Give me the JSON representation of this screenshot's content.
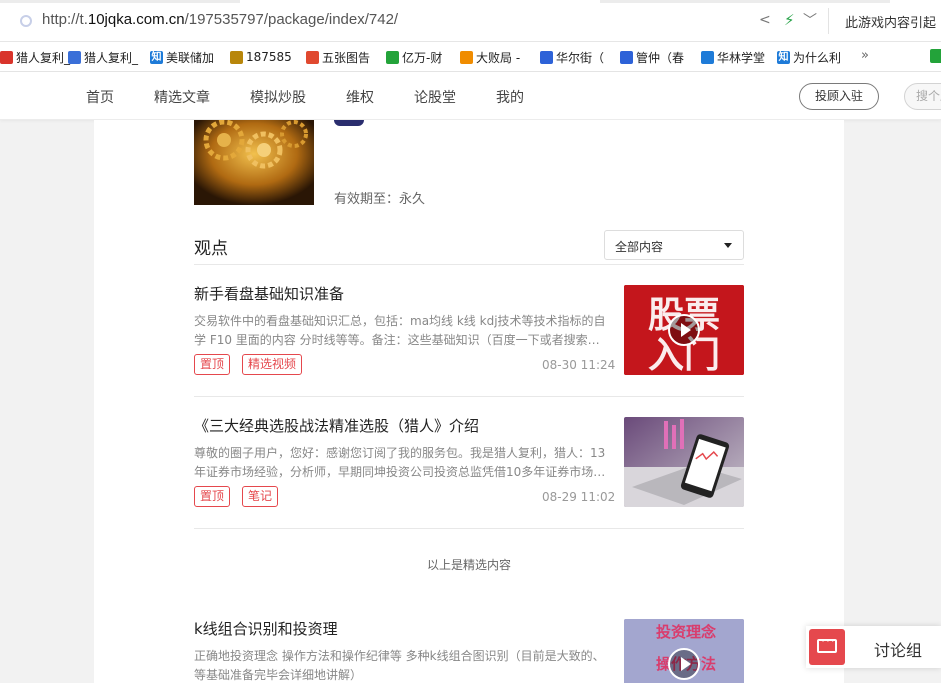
{
  "browser": {
    "url_prefix": "http://t.",
    "url_domain": "10jqka.com.cn",
    "url_path": "/197535797/package/index/742/",
    "right_hint": "此游戏内容引起",
    "share_icon": "share-icon",
    "accelerate_icon": "lightning-icon",
    "menu_icon": "chevron-down-icon",
    "bookmarks": [
      {
        "label": "猎人复利_",
        "color": "#d9342b"
      },
      {
        "label": "猎人复利_",
        "color": "#3a6fd8"
      },
      {
        "label": "美联储加",
        "color": "#1e7bd8",
        "glyph": "知"
      },
      {
        "label": "187585",
        "color": "#b8860b"
      },
      {
        "label": "五张图告",
        "color": "#e0492f"
      },
      {
        "label": "亿万-财",
        "color": "#23a33a"
      },
      {
        "label": "大败局 -",
        "color": "#f08c00"
      },
      {
        "label": "华尔街（",
        "color": "#2d62d8"
      },
      {
        "label": "管仲（春",
        "color": "#2d62d8"
      },
      {
        "label": "华林学堂",
        "color": "#1e7bd8"
      },
      {
        "label": "为什么利",
        "color": "#1e7bd8",
        "glyph": "知"
      }
    ],
    "bookmarks_more": "»"
  },
  "nav": {
    "items": [
      "首页",
      "精选文章",
      "模拟炒股",
      "维权",
      "论股堂",
      "我的"
    ],
    "advisor_button": "投顾入驻",
    "search_button": "搜个股"
  },
  "package": {
    "validity_label": "有效期至：永久"
  },
  "viewpoints": {
    "title": "观点",
    "filter_value": "全部内容",
    "articles": [
      {
        "title": "新手看盘基础知识准备",
        "summary": "交易软件中的看盘基础知识汇总，包括：ma均线 k线 kdj技术等技术指标的自学 F10 里面的内容 分时线等等。备注：这些基础知识（百度一下或者搜索…",
        "tags": [
          "置顶",
          "精选视频"
        ],
        "date": "08-30 11:24",
        "thumb_text_top": "股票",
        "thumb_text_bottom": "入门"
      },
      {
        "title": "《三大经典选股战法精准选股（猎人》介绍",
        "summary": "尊敬的圈子用户，您好：感谢您订阅了我的服务包。我是猎人复利，猎人：13年证券市场经验，分析师，早期同坤投资公司投资总监凭借10多年证券市场…",
        "tags": [
          "置顶",
          "笔记"
        ],
        "date": "08-29 11:02"
      },
      {
        "title": "k线组合识别和投资理",
        "summary": "正确地投资理念 操作方法和操作纪律等 多种k线组合图识别（目前是大致的、等基础准备完毕会详细地讲解）",
        "thumb_text_top": "投资理念",
        "thumb_text_bottom": "操作方法"
      }
    ],
    "end_note": "以上是精选内容"
  },
  "float": {
    "discussion_label": "讨论组"
  }
}
